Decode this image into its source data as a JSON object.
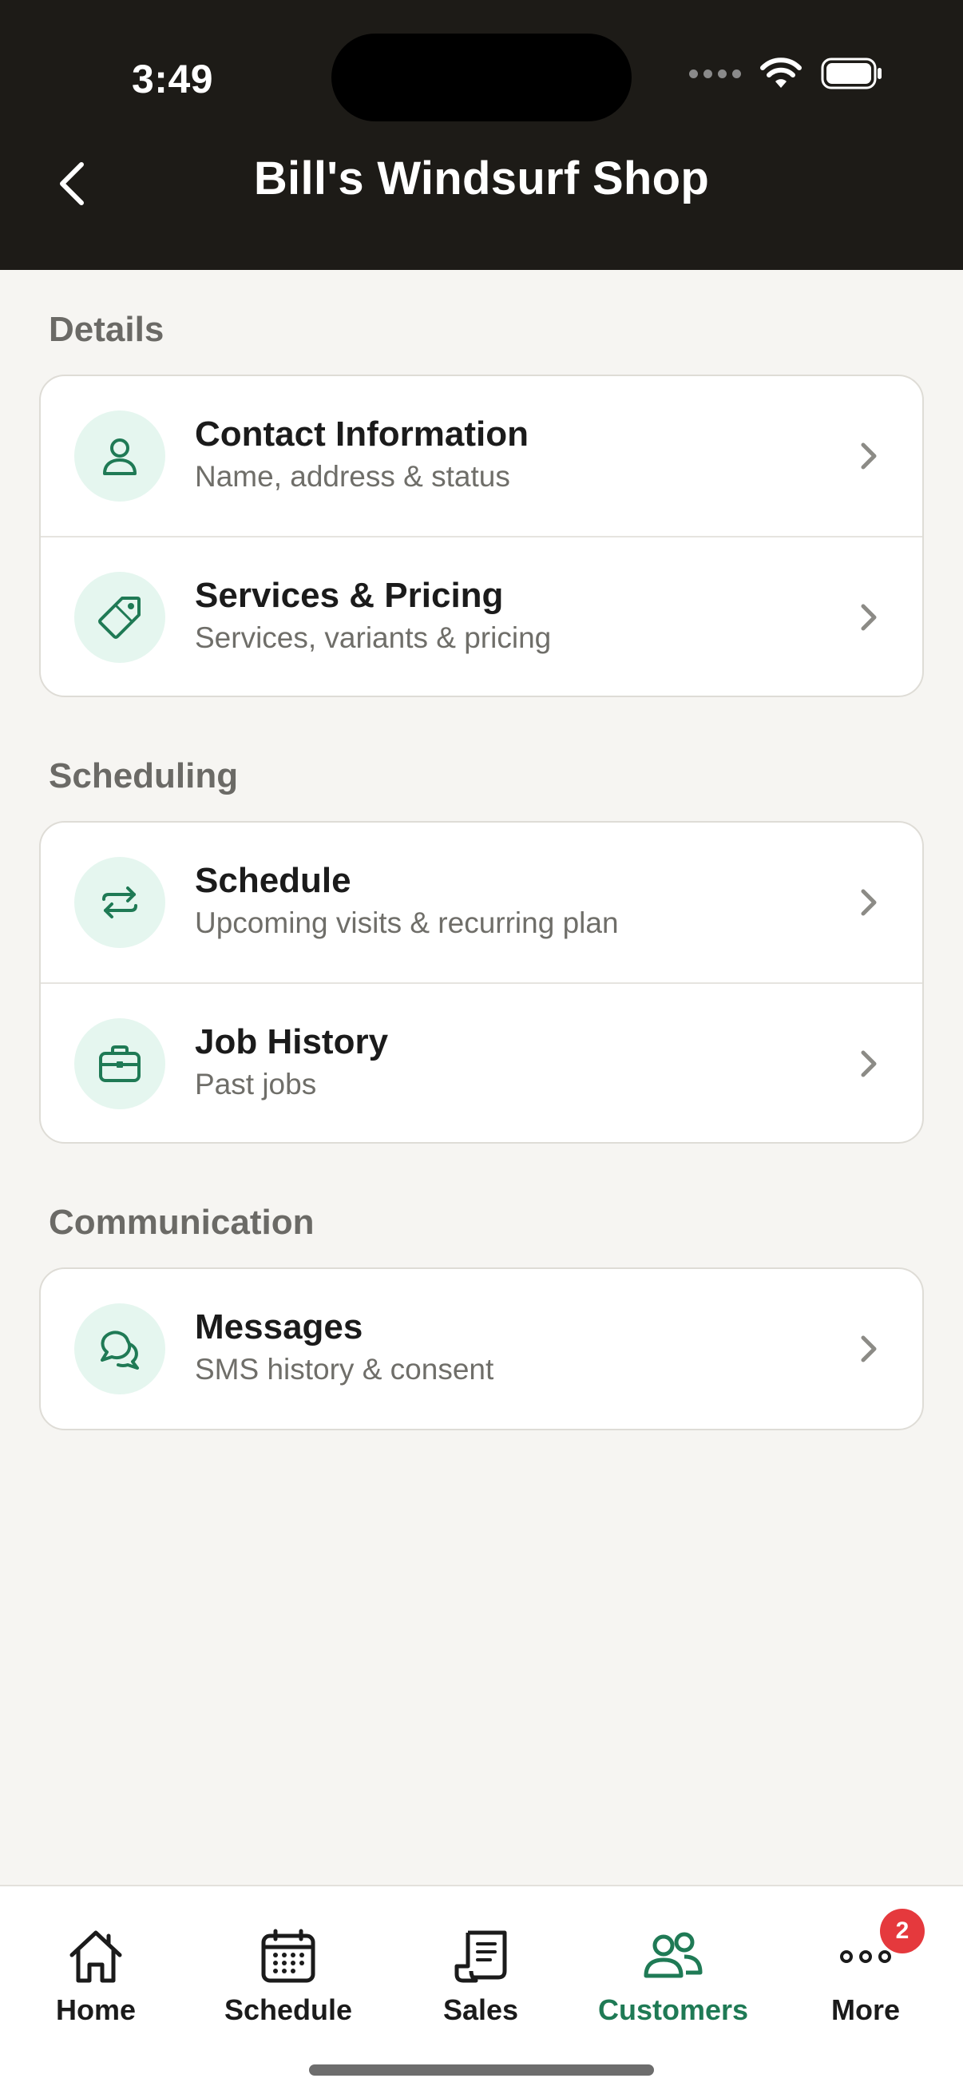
{
  "status_bar": {
    "time": "3:49"
  },
  "header": {
    "title": "Bill's Windsurf Shop"
  },
  "sections": [
    {
      "label": "Details",
      "items": [
        {
          "title": "Contact Information",
          "subtitle": "Name, address & status",
          "icon": "person-icon"
        },
        {
          "title": "Services & Pricing",
          "subtitle": "Services, variants & pricing",
          "icon": "tag-icon"
        }
      ]
    },
    {
      "label": "Scheduling",
      "items": [
        {
          "title": "Schedule",
          "subtitle": "Upcoming visits & recurring plan",
          "icon": "repeat-icon"
        },
        {
          "title": "Job History",
          "subtitle": "Past jobs",
          "icon": "briefcase-icon"
        }
      ]
    },
    {
      "label": "Communication",
      "items": [
        {
          "title": "Messages",
          "subtitle": "SMS history & consent",
          "icon": "chat-icon"
        }
      ]
    }
  ],
  "tabbar": {
    "items": [
      {
        "label": "Home",
        "icon": "home-icon"
      },
      {
        "label": "Schedule",
        "icon": "calendar-icon"
      },
      {
        "label": "Sales",
        "icon": "receipt-icon"
      },
      {
        "label": "Customers",
        "icon": "customers-icon",
        "active": true
      },
      {
        "label": "More",
        "icon": "more-icon",
        "badge": "2"
      }
    ]
  },
  "colors": {
    "accent": "#1f7a55",
    "icon_bg": "#e5f6ef",
    "header_bg": "#1d1b17",
    "badge": "#e5393d"
  }
}
